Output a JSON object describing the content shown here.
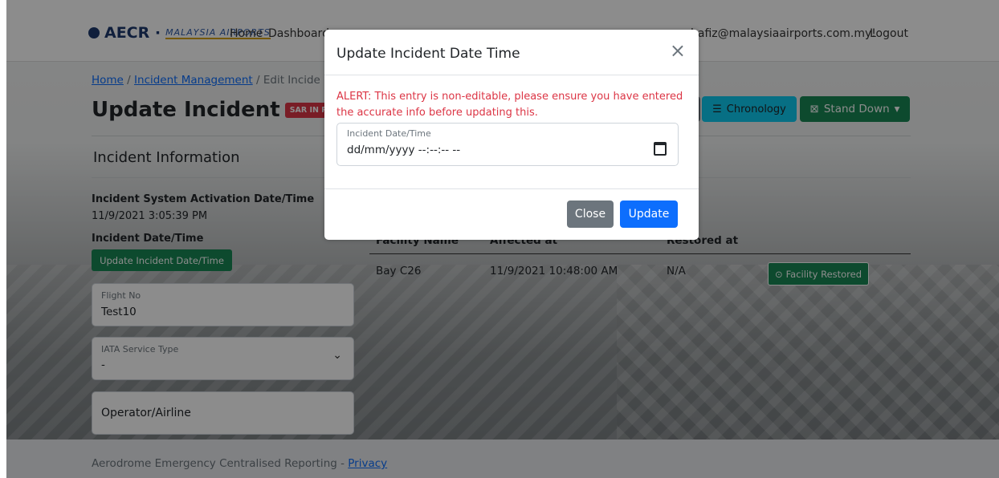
{
  "brand": {
    "name": "AECR ·",
    "logo_text": "MALAYSIA AIRPORTS"
  },
  "nav": {
    "home": "Home",
    "dashboard": "Dashboard",
    "user_email": "hafiz@malaysiaairports.com.my!",
    "logout": "Logout"
  },
  "breadcrumb": {
    "home": "Home",
    "sep1": "/",
    "incident_mgmt": "Incident Management",
    "sep2": "/",
    "current": "Edit Incide"
  },
  "page": {
    "title": "Update Incident",
    "status_badge": "SAR IN PROGRESS",
    "chronology_label": "Chronology",
    "stand_down_label": "Stand Down"
  },
  "incident_info": {
    "section_title": "Incident Information",
    "activation_label": "Incident System Activation Date/Time",
    "activation_value": "11/9/2021 3:05:39 PM",
    "date_time_label": "Incident Date/Time",
    "update_date_button": "Update Incident Date/Time",
    "flight_no_label": "Flight No",
    "flight_no_value": "Test10",
    "iata_label": "IATA Service Type",
    "iata_value": "-",
    "operator_label": "Operator/Airline"
  },
  "facility_table": {
    "headers": [
      "Facility Name",
      "Affected at",
      "Restored at"
    ],
    "rows": [
      {
        "facility": "Bay C26",
        "affected": "11/9/2021 10:48:00 AM",
        "restored": "N/A",
        "action": "Facility Restored"
      }
    ]
  },
  "modal": {
    "title": "Update Incident Date Time",
    "close_symbol": "×",
    "alert": "ALERT: This entry is non-editable, please ensure you have entered the accurate info before updating this.",
    "field_label": "Incident Date/Time",
    "field_value": "dd/mm/yyyy --:--:-- --",
    "close_button": "Close",
    "update_button": "Update"
  },
  "footer": {
    "text": "Aerodrome Emergency Centralised Reporting -",
    "privacy": "Privacy"
  },
  "colors": {
    "primary": "#0d6efd",
    "success": "#198754",
    "danger": "#dc3545",
    "info": "#0dcaf0",
    "secondary": "#6c757d"
  }
}
